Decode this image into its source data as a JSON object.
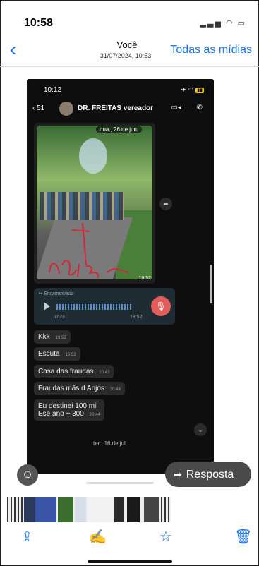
{
  "status_bar": {
    "time": "10:58"
  },
  "nav": {
    "back_icon": "chevron-left-icon",
    "title": "Você",
    "subtitle": "31/07/2024, 10:53",
    "all_media": "Todas as mídias"
  },
  "screenshot": {
    "status_time": "10:12",
    "header": {
      "back_count": "51",
      "contact": "DR. FREITAS vereador"
    },
    "image_message": {
      "date": "qua., 26 de jun.",
      "time": "19:52"
    },
    "audio_message": {
      "forwarded": "Encaminhada",
      "duration": "0:33",
      "time": "19:52"
    },
    "messages": [
      {
        "text": "Kkk",
        "time": "19:52"
      },
      {
        "text": "Escuta",
        "time": "19:52"
      },
      {
        "text": "Casa das fraudas",
        "time": "20:43"
      },
      {
        "text": "Fraudas mãs d Anjos",
        "time": "20:44"
      },
      {
        "text": "Eu destinei 100 mil\nEse ano + 300",
        "time": "20:44"
      }
    ],
    "day_separator": "ter., 16 de jul."
  },
  "reply_button": "Resposta",
  "toolbar": {
    "share_icon": "share-icon",
    "markup_icon": "markup-icon",
    "favorite_icon": "star-icon",
    "delete_icon": "trash-icon"
  },
  "colors": {
    "accent": "#1a73e8",
    "chat_bg": "#0e0e0e",
    "mic": "#e35d5b"
  }
}
